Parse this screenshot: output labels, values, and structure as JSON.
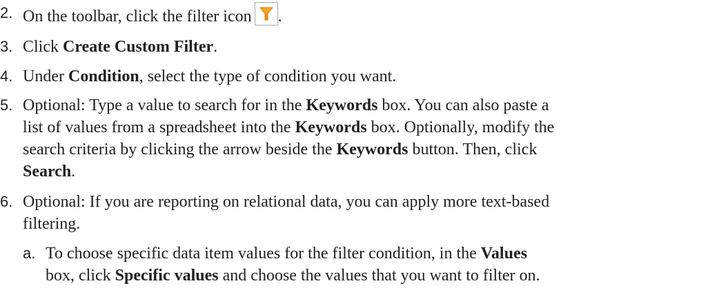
{
  "steps": [
    {
      "num": "2.",
      "lines": [
        {
          "parts": [
            "On the toolbar, click the filter icon",
            "",
            ""
          ],
          "icon": true,
          "after": "."
        }
      ]
    },
    {
      "num": "3.",
      "lines": [
        {
          "parts": [
            "Click ",
            "Create Custom Filter",
            "."
          ]
        }
      ]
    },
    {
      "num": "4.",
      "lines": [
        {
          "parts": [
            "Under ",
            "Condition",
            ", select the type of condition you want."
          ]
        }
      ]
    },
    {
      "num": "5.",
      "lines": [
        {
          "parts": [
            "Optional: Type a value to search for in the ",
            "Keywords",
            " box. You can also paste a"
          ]
        },
        {
          "parts": [
            "list of values from a spreadsheet into the ",
            "Keywords",
            " box. Optionally, modify the"
          ]
        },
        {
          "parts": [
            "search criteria by clicking the arrow beside the ",
            "Keywords",
            " button. Then, click"
          ]
        },
        {
          "parts": [
            "",
            "Search",
            "."
          ]
        }
      ]
    },
    {
      "num": "6.",
      "lines": [
        {
          "parts": [
            "Optional: If you are reporting on relational data, you can apply more text-based",
            "",
            ""
          ]
        },
        {
          "parts": [
            "filtering.",
            "",
            ""
          ]
        }
      ]
    }
  ],
  "substep": {
    "num": "a.",
    "line1": {
      "pre": "To choose specific data item values for the filter condition, in the ",
      "bold": "Values"
    },
    "line2": {
      "pre": "box, click ",
      "bold": "Specific values",
      "post": " and choose the values that you want to filter on."
    }
  },
  "icon": {
    "name": "filter-icon",
    "color_top": "#f7a41d",
    "color_stem": "#e8891b"
  }
}
